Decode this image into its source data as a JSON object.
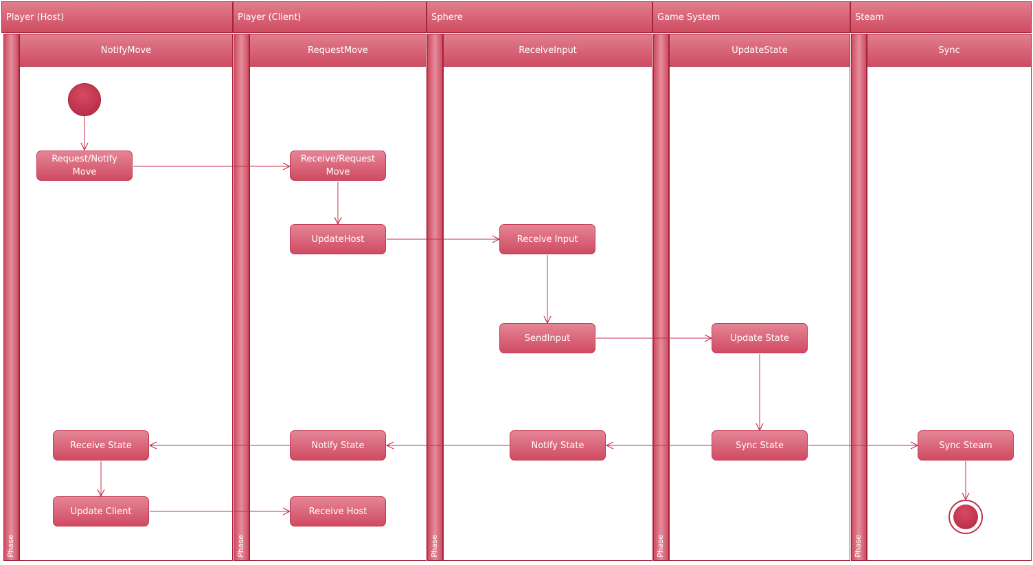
{
  "lanes": [
    {
      "title": "Player (Host)",
      "sub": "NotifyMove",
      "phase": "Phase"
    },
    {
      "title": "Player (Client)",
      "sub": "RequestMove",
      "phase": "Phase"
    },
    {
      "title": "Sphere",
      "sub": "ReceiveInput",
      "phase": "Phase"
    },
    {
      "title": "Game System",
      "sub": "UpdateState",
      "phase": "Phase"
    },
    {
      "title": "Steam",
      "sub": "Sync",
      "phase": "Phase"
    }
  ],
  "nodes": {
    "request_notify_move": "Request/Notify Move",
    "receive_request_move": "Receive/Request Move",
    "update_host": "UpdateHost",
    "receive_input": "Receive Input",
    "send_input": "SendInput",
    "update_state": "Update State",
    "sync_state": "Sync State",
    "sync_steam": "Sync Steam",
    "notify_state_sphere": "Notify State",
    "notify_state_client": "Notify State",
    "receive_state": "Receive State",
    "update_client": "Update Client",
    "receive_host": "Receive Host"
  },
  "colors": {
    "accent": "#cf4c62",
    "border": "#a3233a",
    "edge": "#c0304a"
  }
}
